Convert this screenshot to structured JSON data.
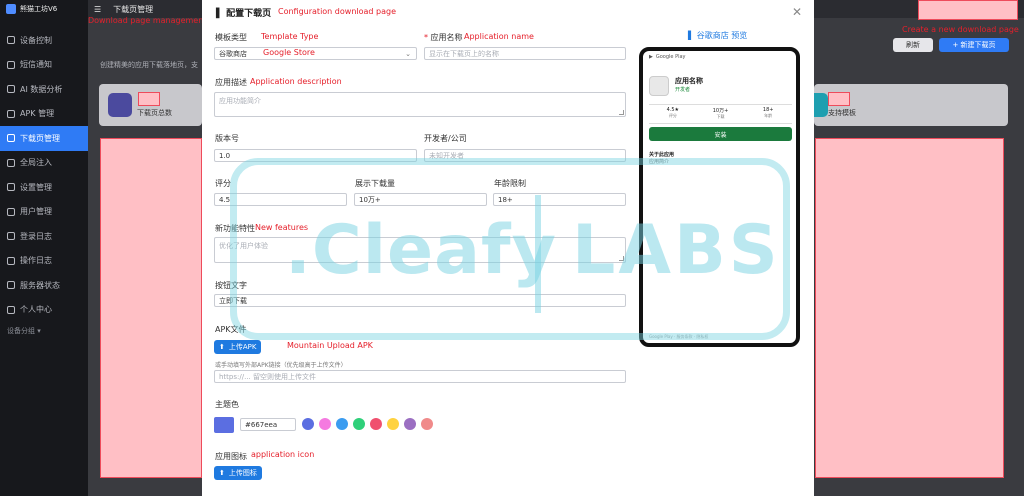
{
  "sidebar": {
    "brand": "熊猫工坊V6",
    "items": [
      {
        "label": "设备控制",
        "icon": "device-icon"
      },
      {
        "label": "短信通知",
        "icon": "sms-icon"
      },
      {
        "label": "AI 数据分析",
        "icon": "ai-icon"
      },
      {
        "label": "APK 管理",
        "icon": "apk-icon"
      },
      {
        "label": "下载页管理",
        "icon": "download-icon"
      },
      {
        "label": "全局注入",
        "icon": "inject-icon"
      },
      {
        "label": "设置管理",
        "icon": "settings-icon"
      },
      {
        "label": "用户管理",
        "icon": "user-icon"
      },
      {
        "label": "登录日志",
        "icon": "login-log-icon"
      },
      {
        "label": "操作日志",
        "icon": "op-log-icon"
      },
      {
        "label": "服务器状态",
        "icon": "server-icon"
      },
      {
        "label": "个人中心",
        "icon": "profile-icon"
      }
    ],
    "group_label": "设备分组"
  },
  "topbar": {
    "title": "下载页管理"
  },
  "background": {
    "page_desc": "创建精美的应用下载落地页，支",
    "card_left_label": "下载页总数",
    "card_right_label": "支持模板",
    "refresh_label": "刷新",
    "new_label": "+ 新建下载页"
  },
  "annotations": {
    "download_page_management": "Download page management",
    "create_new": "Create a new download page",
    "config": "Configuration download page",
    "template_type": "Template Type",
    "google_store": "Google Store",
    "app_name": "Application name",
    "app_desc": "Application description",
    "new_features": "New features",
    "mountain_upload": "Mountain Upload APK",
    "app_icon": "application icon"
  },
  "modal": {
    "title": "配置下载页",
    "template_label": "模板类型",
    "template_value": "谷歌商店",
    "app_name_label": "应用名称",
    "app_name_placeholder": "显示在下载页上的名称",
    "desc_label": "应用描述",
    "desc_placeholder": "应用功能简介",
    "version_label": "版本号",
    "version_value": "1.0",
    "developer_label": "开发者/公司",
    "developer_placeholder": "未知开发者",
    "rating_label": "评分",
    "rating_value": "4.5",
    "downloads_label": "展示下载量",
    "downloads_value": "10万+",
    "age_label": "年龄限制",
    "age_value": "18+",
    "features_label": "新功能特性",
    "features_placeholder": "优化了用户体验",
    "button_text_label": "按钮文字",
    "button_text_value": "立即下载",
    "apk_label": "APK文件",
    "upload_apk_label": "上传APK",
    "manual_hint": "或手动填写外部APK链接（优先级高于上传文件）",
    "apk_url_placeholder": "https://... 留空则使用上传文件",
    "theme_label": "主题色",
    "theme_value": "#667eea",
    "icon_label": "应用图标",
    "upload_icon_label": "上传图标"
  },
  "colors": {
    "theme": "#667eea",
    "presets": [
      "#5b6ee1",
      "#f57ae0",
      "#3b9cf0",
      "#2fd07a",
      "#f0506e",
      "#ffd23f",
      "#9b6fc2",
      "#f08a8a"
    ]
  },
  "preview": {
    "title": "谷歌商店 预览",
    "store_name": "Google Play",
    "app_name": "应用名称",
    "developer": "开发者",
    "stats": [
      {
        "value": "4.5★",
        "label": "评分"
      },
      {
        "value": "10万+",
        "label": "下载"
      },
      {
        "value": "18+",
        "label": "年龄"
      }
    ],
    "install": "安装",
    "about_title": "关于此应用",
    "intro": "应用简介",
    "footer": "Google Play · 服务条款 · 隐私权"
  },
  "watermark": {
    "left": ".Cleafy",
    "right": "LABS"
  }
}
